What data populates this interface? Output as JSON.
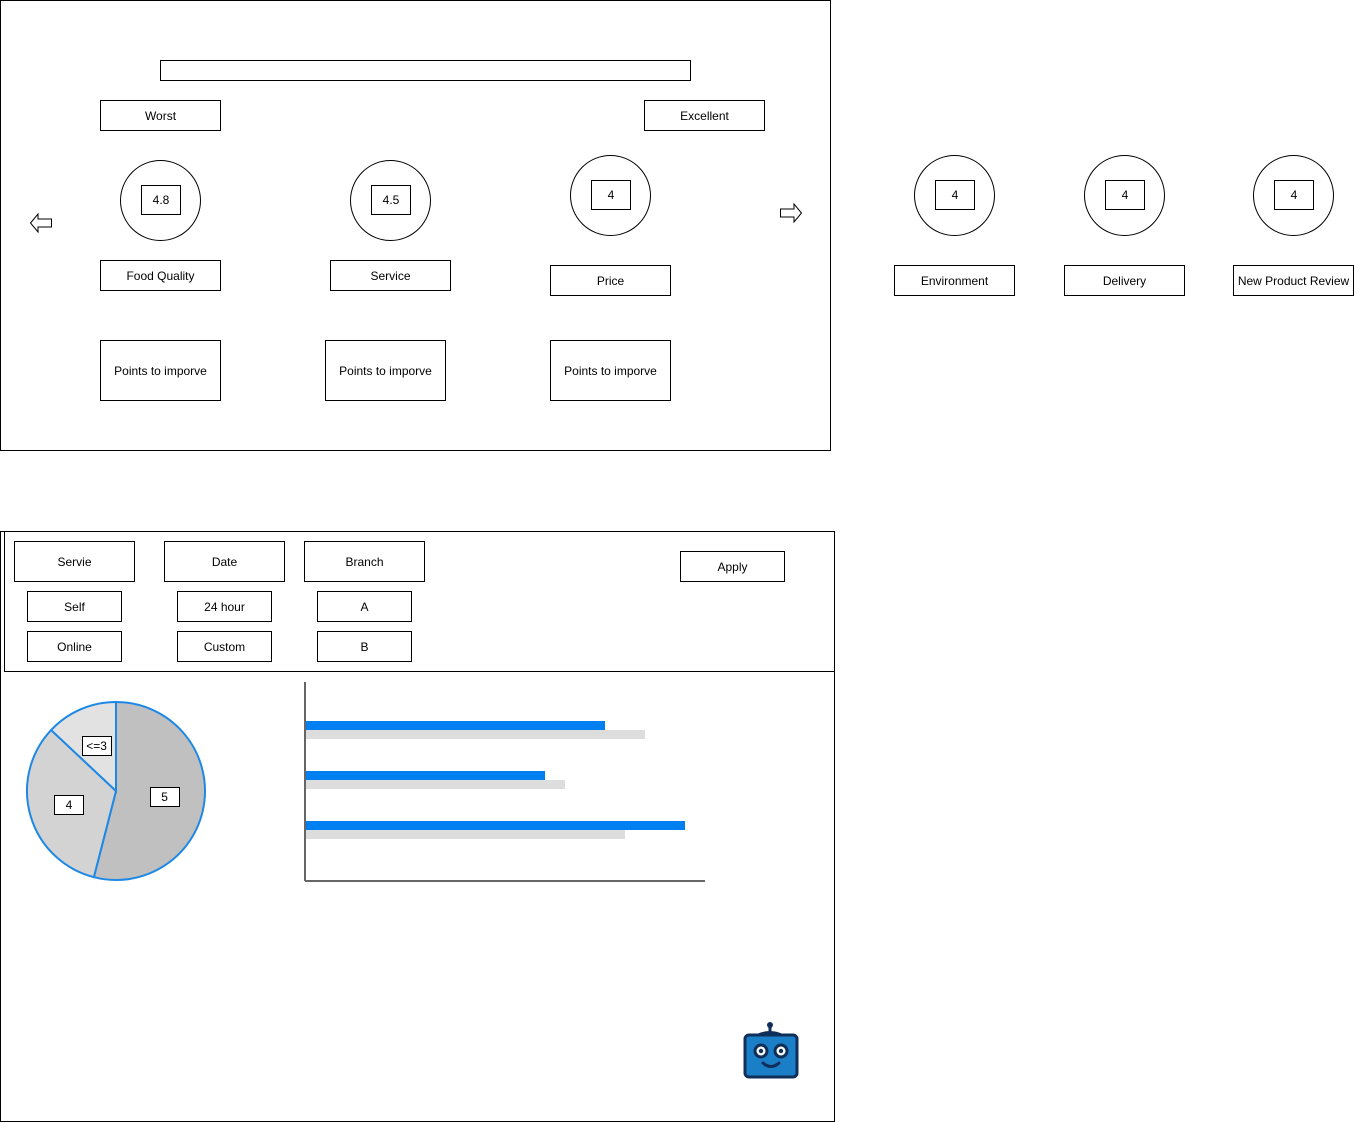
{
  "rating_panel": {
    "scale": {
      "low_label": "Worst",
      "high_label": "Excellent"
    },
    "nav": {
      "prev_icon": "arrow-left-icon",
      "next_icon": "arrow-right-icon"
    },
    "categories": [
      {
        "label": "Food Quality",
        "score": "4.8",
        "improve_label": "Points to imporve"
      },
      {
        "label": "Service",
        "score": "4.5",
        "improve_label": "Points to imporve"
      },
      {
        "label": "Price",
        "score": "4",
        "improve_label": "Points to imporve"
      }
    ],
    "offscreen_categories": [
      {
        "label": "Environment",
        "score": "4"
      },
      {
        "label": "Delivery",
        "score": "4"
      },
      {
        "label": "New Product Review",
        "score": "4"
      }
    ]
  },
  "filters": {
    "service": {
      "label": "Servie",
      "options": [
        "Self",
        "Online"
      ]
    },
    "date": {
      "label": "Date",
      "options": [
        "24 hour",
        "Custom"
      ]
    },
    "branch": {
      "label": "Branch",
      "options": [
        "A",
        "B"
      ]
    },
    "apply_label": "Apply"
  },
  "assistant": {
    "icon": "robot-icon",
    "colors": {
      "body": "#1b7fc7",
      "outline": "#0f2f5a"
    }
  },
  "chart_data": [
    {
      "type": "pie",
      "slices": [
        {
          "label": "5",
          "value": 54
        },
        {
          "label": "4",
          "value": 33
        },
        {
          "label": "<=3",
          "value": 13
        }
      ],
      "colors": [
        "#c0c0c0",
        "#d3d3d3",
        "#e2e2e2"
      ],
      "outline_color": "#1e88e5"
    },
    {
      "type": "bar",
      "orientation": "horizontal",
      "categories": [
        "",
        "",
        ""
      ],
      "series": [
        {
          "values": [
            75,
            60,
            95
          ],
          "color": "#0080f0"
        },
        {
          "values": [
            85,
            65,
            80
          ],
          "color": "#dddddd"
        }
      ],
      "xlim": [
        0,
        100
      ],
      "grid": false
    }
  ]
}
